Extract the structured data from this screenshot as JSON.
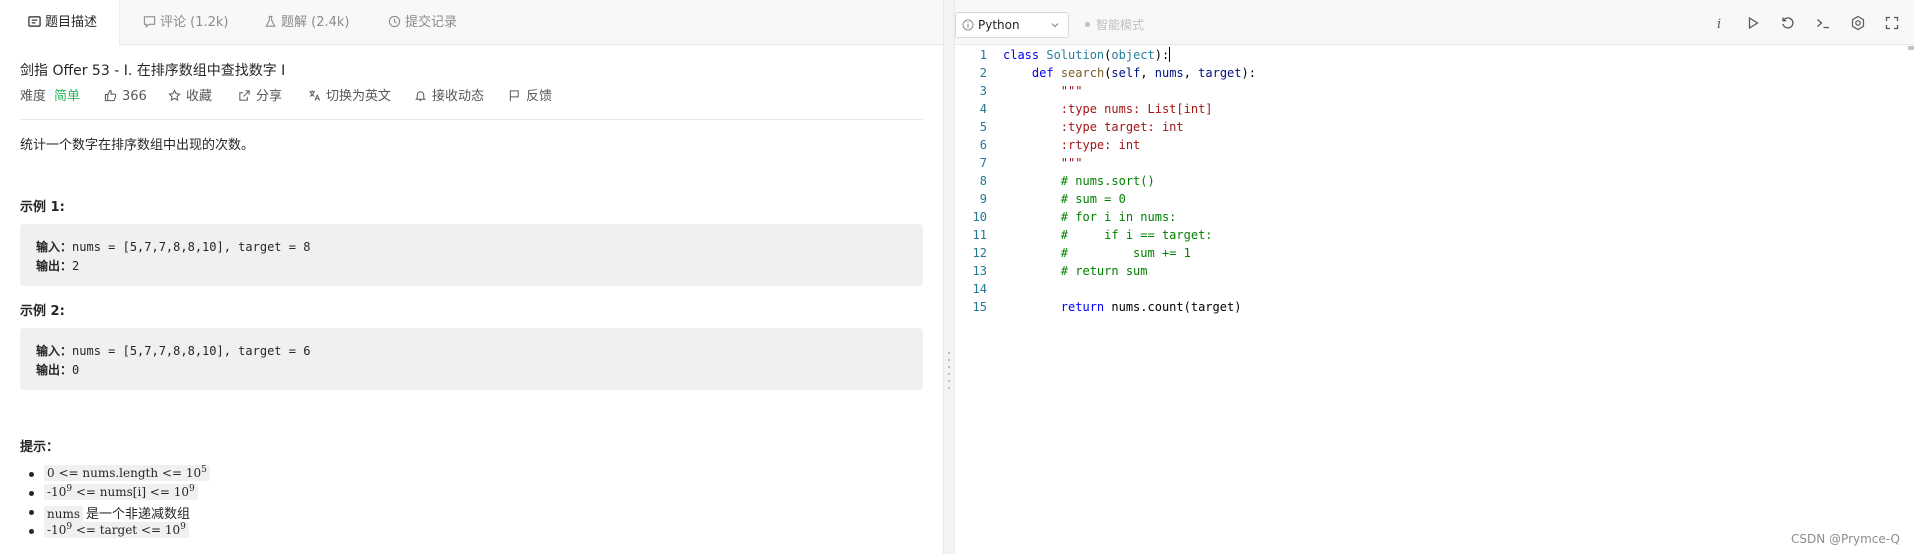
{
  "left_tabs": [
    {
      "label": "题目描述",
      "icon": "description-icon"
    },
    {
      "label": "评论 (1.2k)",
      "icon": "comment-icon"
    },
    {
      "label": "题解 (2.4k)",
      "icon": "flask-icon"
    },
    {
      "label": "提交记录",
      "icon": "history-icon"
    }
  ],
  "problem": {
    "title": "剑指 Offer 53 - I. 在排序数组中查找数字 I",
    "difficulty_label": "难度",
    "difficulty": "简单",
    "likes": "366",
    "favorite": "收藏",
    "share": "分享",
    "translate": "切换为英文",
    "subscribe": "接收动态",
    "feedback": "反馈",
    "description": "统计一个数字在排序数组中出现的次数。",
    "examples": [
      {
        "heading": "示例 1:",
        "input_label": "输入：",
        "input": "nums = [5,7,7,8,8,10], target = 8",
        "output_label": "输出：",
        "output": "2"
      },
      {
        "heading": "示例 2:",
        "input_label": "输入：",
        "input": "nums = [5,7,7,8,8,10], target = 6",
        "output_label": "输出：",
        "output": "0"
      }
    ],
    "hints_heading": "提示：",
    "hints": [
      {
        "a": "0 <= nums.length <= 10",
        "sup": "5",
        "b": ""
      },
      {
        "a": "-10",
        "sup": "9",
        "b": " <= nums[i] <= 10",
        "sup2": "9"
      },
      {
        "a": "nums",
        "text": "是一个非递减数组"
      },
      {
        "a": "-10",
        "sup": "9",
        "b": " <= target <= 10",
        "sup2": "9"
      }
    ]
  },
  "editor": {
    "language": "Python",
    "smart_mode": "智能模式",
    "toolbar_icons": [
      "info-icon",
      "run-icon",
      "reset-icon",
      "console-icon",
      "settings-icon",
      "fullscreen-icon"
    ],
    "lines": [
      "class Solution(object):",
      "    def search(self, nums, target):",
      "        \"\"\"",
      "        :type nums: List[int]",
      "        :type target: int",
      "        :rtype: int",
      "        \"\"\"",
      "        # nums.sort()",
      "        # sum = 0",
      "        # for i in nums:",
      "        #     if i == target:",
      "        #         sum += 1",
      "        # return sum",
      "",
      "        return nums.count(target)"
    ]
  },
  "watermark": "CSDN @Prymce-Q"
}
